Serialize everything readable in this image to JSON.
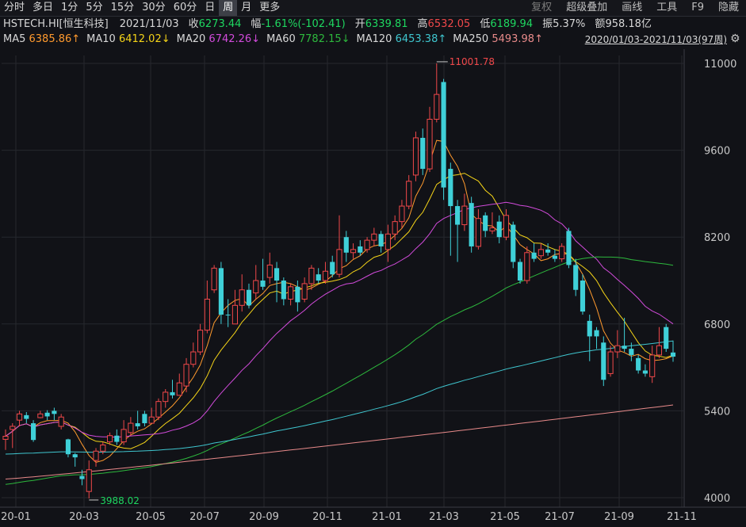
{
  "toolbar": {
    "tabs": [
      "分时",
      "多日",
      "1分",
      "5分",
      "15分",
      "30分",
      "60分",
      "日",
      "周",
      "月",
      "更多"
    ],
    "active_tab": "周",
    "tools": [
      "复权",
      "超级叠加",
      "画线",
      "工具",
      "F9",
      "隐藏"
    ]
  },
  "quote": {
    "symbol": "HSTECH.HI[恒生科技]",
    "date": "2021/11/03",
    "close_label": "收",
    "close": "6273.44",
    "change_label": "幅",
    "change": "-1.61%(-102.41)",
    "open_label": "开",
    "open": "6339.81",
    "high_label": "高",
    "high": "6532.05",
    "low_label": "低",
    "low": "6189.94",
    "amplitude_label": "振",
    "amplitude": "5.37%",
    "amount_label": "额",
    "amount": "958.18亿"
  },
  "ma_legend": [
    {
      "label": "MA5",
      "value": "6385.86↑",
      "color": "#ff9a2e"
    },
    {
      "label": "MA10",
      "value": "6412.02↓",
      "color": "#f5d418"
    },
    {
      "label": "MA20",
      "value": "6742.26↓",
      "color": "#d24bdb"
    },
    {
      "label": "MA60",
      "value": "7782.15↓",
      "color": "#2db83d"
    },
    {
      "label": "MA120",
      "value": "6453.38↑",
      "color": "#3fc6cf"
    },
    {
      "label": "MA250",
      "value": "5493.98↑",
      "color": "#e88a8a"
    }
  ],
  "range_label": "2020/01/03-2021/11/03(97周)",
  "colors": {
    "up": "#f0484a",
    "down": "#3fd0d8",
    "grid": "#26282e",
    "axis_text": "#c8c8c8"
  },
  "chart_data": {
    "type": "candlestick",
    "yticks": [
      4000,
      5400,
      6800,
      8200,
      9600,
      11000
    ],
    "ylim": [
      3900,
      11150
    ],
    "xticks": [
      "20-01",
      "20-03",
      "20-05",
      "20-07",
      "20-09",
      "20-11",
      "21-01",
      "21-03",
      "21-05",
      "21-07",
      "21-09",
      "21-11"
    ],
    "max_label": "11001.78",
    "min_label": "3988.02",
    "candles": [
      {
        "o": 4940,
        "c": 4990,
        "h": 5100,
        "l": 4770,
        "up": true
      },
      {
        "o": 5100,
        "c": 5150,
        "h": 5200,
        "l": 4800,
        "up": true
      },
      {
        "o": 5250,
        "c": 5350,
        "h": 5400,
        "l": 5150,
        "up": true
      },
      {
        "o": 5330,
        "c": 5270,
        "h": 5380,
        "l": 5200,
        "up": false
      },
      {
        "o": 5200,
        "c": 4930,
        "h": 5250,
        "l": 4900,
        "up": false
      },
      {
        "o": 5290,
        "c": 5350,
        "h": 5400,
        "l": 5280,
        "up": true
      },
      {
        "o": 5370,
        "c": 5310,
        "h": 5410,
        "l": 5250,
        "up": false
      },
      {
        "o": 5400,
        "c": 5350,
        "h": 5450,
        "l": 5250,
        "up": false
      },
      {
        "o": 5150,
        "c": 5300,
        "h": 5350,
        "l": 5100,
        "up": true
      },
      {
        "o": 4940,
        "c": 4700,
        "h": 4950,
        "l": 4650,
        "up": false
      },
      {
        "o": 4700,
        "c": 4650,
        "h": 4720,
        "l": 4500,
        "up": false
      },
      {
        "o": 4350,
        "c": 4300,
        "h": 4450,
        "l": 4200,
        "up": false
      },
      {
        "o": 4100,
        "c": 4450,
        "h": 4600,
        "l": 3988,
        "up": true
      },
      {
        "o": 4600,
        "c": 4750,
        "h": 4800,
        "l": 4500,
        "up": true
      },
      {
        "o": 4750,
        "c": 4850,
        "h": 4900,
        "l": 4700,
        "up": true
      },
      {
        "o": 4900,
        "c": 5000,
        "h": 5050,
        "l": 4850,
        "up": true
      },
      {
        "o": 5000,
        "c": 4900,
        "h": 5100,
        "l": 4850,
        "up": false
      },
      {
        "o": 4900,
        "c": 5100,
        "h": 5250,
        "l": 4850,
        "up": true
      },
      {
        "o": 5050,
        "c": 5200,
        "h": 5300,
        "l": 5000,
        "up": true
      },
      {
        "o": 5200,
        "c": 5150,
        "h": 5400,
        "l": 5100,
        "up": false
      },
      {
        "o": 5350,
        "c": 5200,
        "h": 5400,
        "l": 5150,
        "up": false
      },
      {
        "o": 5200,
        "c": 5300,
        "h": 5450,
        "l": 5200,
        "up": true
      },
      {
        "o": 5300,
        "c": 5550,
        "h": 5600,
        "l": 5250,
        "up": true
      },
      {
        "o": 5550,
        "c": 5700,
        "h": 5750,
        "l": 5450,
        "up": true
      },
      {
        "o": 5700,
        "c": 5650,
        "h": 5900,
        "l": 5600,
        "up": false
      },
      {
        "o": 5650,
        "c": 5850,
        "h": 6000,
        "l": 5650,
        "up": true
      },
      {
        "o": 5800,
        "c": 6150,
        "h": 6250,
        "l": 5700,
        "up": true
      },
      {
        "o": 6150,
        "c": 6350,
        "h": 6500,
        "l": 6100,
        "up": true
      },
      {
        "o": 6350,
        "c": 6700,
        "h": 6800,
        "l": 6300,
        "up": true
      },
      {
        "o": 6700,
        "c": 7200,
        "h": 7500,
        "l": 6650,
        "up": true
      },
      {
        "o": 7350,
        "c": 7700,
        "h": 7750,
        "l": 7300,
        "up": true
      },
      {
        "o": 7700,
        "c": 6950,
        "h": 7800,
        "l": 6800,
        "up": false
      },
      {
        "o": 6950,
        "c": 6950,
        "h": 7200,
        "l": 6750,
        "up": false
      },
      {
        "o": 6800,
        "c": 7100,
        "h": 7350,
        "l": 6800,
        "up": true
      },
      {
        "o": 7100,
        "c": 7350,
        "h": 7600,
        "l": 7000,
        "up": true
      },
      {
        "o": 7350,
        "c": 7100,
        "h": 7450,
        "l": 7050,
        "up": false
      },
      {
        "o": 7300,
        "c": 7500,
        "h": 7750,
        "l": 7200,
        "up": true
      },
      {
        "o": 7500,
        "c": 7400,
        "h": 7850,
        "l": 7350,
        "up": false
      },
      {
        "o": 7550,
        "c": 7750,
        "h": 7950,
        "l": 7450,
        "up": true
      },
      {
        "o": 7700,
        "c": 7500,
        "h": 7800,
        "l": 7150,
        "up": false
      },
      {
        "o": 7500,
        "c": 7200,
        "h": 7550,
        "l": 7100,
        "up": false
      },
      {
        "o": 7200,
        "c": 7400,
        "h": 7450,
        "l": 7100,
        "up": true
      },
      {
        "o": 7400,
        "c": 7150,
        "h": 7500,
        "l": 7000,
        "up": false
      },
      {
        "o": 7200,
        "c": 7450,
        "h": 7550,
        "l": 7150,
        "up": true
      },
      {
        "o": 7450,
        "c": 7700,
        "h": 7750,
        "l": 7350,
        "up": true
      },
      {
        "o": 7600,
        "c": 7500,
        "h": 7700,
        "l": 7450,
        "up": false
      },
      {
        "o": 7500,
        "c": 7650,
        "h": 7800,
        "l": 7450,
        "up": true
      },
      {
        "o": 7800,
        "c": 7600,
        "h": 7900,
        "l": 7550,
        "up": false
      },
      {
        "o": 7600,
        "c": 8000,
        "h": 8550,
        "l": 7550,
        "up": true
      },
      {
        "o": 8200,
        "c": 7950,
        "h": 8300,
        "l": 7800,
        "up": false
      },
      {
        "o": 7950,
        "c": 8000,
        "h": 8100,
        "l": 7850,
        "up": true
      },
      {
        "o": 8050,
        "c": 7950,
        "h": 8150,
        "l": 7900,
        "up": false
      },
      {
        "o": 8000,
        "c": 8150,
        "h": 8200,
        "l": 7950,
        "up": true
      },
      {
        "o": 8150,
        "c": 8250,
        "h": 8350,
        "l": 8050,
        "up": true
      },
      {
        "o": 8250,
        "c": 8050,
        "h": 8300,
        "l": 7950,
        "up": false
      },
      {
        "o": 8000,
        "c": 8250,
        "h": 8400,
        "l": 7800,
        "up": true
      },
      {
        "o": 8250,
        "c": 8450,
        "h": 8550,
        "l": 8150,
        "up": true
      },
      {
        "o": 8450,
        "c": 8700,
        "h": 8800,
        "l": 8350,
        "up": true
      },
      {
        "o": 8700,
        "c": 9100,
        "h": 9200,
        "l": 8650,
        "up": true
      },
      {
        "o": 9200,
        "c": 9800,
        "h": 9900,
        "l": 9100,
        "up": true
      },
      {
        "o": 9800,
        "c": 9300,
        "h": 9950,
        "l": 9200,
        "up": false
      },
      {
        "o": 9300,
        "c": 10100,
        "h": 10300,
        "l": 9250,
        "up": true
      },
      {
        "o": 10100,
        "c": 10500,
        "h": 11001,
        "l": 10050,
        "up": true
      },
      {
        "o": 10700,
        "c": 9000,
        "h": 10750,
        "l": 8800,
        "up": false
      },
      {
        "o": 9300,
        "c": 8700,
        "h": 9400,
        "l": 7900,
        "up": false
      },
      {
        "o": 8700,
        "c": 8400,
        "h": 8800,
        "l": 7800,
        "up": false
      },
      {
        "o": 8400,
        "c": 8700,
        "h": 8900,
        "l": 8300,
        "up": true
      },
      {
        "o": 8750,
        "c": 8050,
        "h": 8850,
        "l": 7950,
        "up": false
      },
      {
        "o": 8050,
        "c": 8500,
        "h": 8650,
        "l": 8000,
        "up": true
      },
      {
        "o": 8550,
        "c": 8300,
        "h": 8600,
        "l": 8200,
        "up": false
      },
      {
        "o": 8300,
        "c": 8350,
        "h": 8600,
        "l": 8250,
        "up": true
      },
      {
        "o": 8450,
        "c": 8200,
        "h": 8550,
        "l": 8100,
        "up": false
      },
      {
        "o": 8200,
        "c": 8550,
        "h": 8650,
        "l": 8150,
        "up": true
      },
      {
        "o": 8400,
        "c": 7800,
        "h": 8450,
        "l": 7700,
        "up": false
      },
      {
        "o": 7800,
        "c": 7500,
        "h": 7850,
        "l": 7450,
        "up": false
      },
      {
        "o": 7500,
        "c": 7950,
        "h": 8050,
        "l": 7450,
        "up": true
      },
      {
        "o": 7950,
        "c": 7850,
        "h": 8100,
        "l": 7800,
        "up": false
      },
      {
        "o": 7900,
        "c": 8000,
        "h": 8100,
        "l": 7850,
        "up": true
      },
      {
        "o": 8000,
        "c": 7950,
        "h": 8100,
        "l": 7900,
        "up": false
      },
      {
        "o": 7900,
        "c": 7850,
        "h": 8000,
        "l": 7800,
        "up": false
      },
      {
        "o": 7850,
        "c": 8050,
        "h": 8100,
        "l": 7800,
        "up": true
      },
      {
        "o": 8300,
        "c": 7750,
        "h": 8350,
        "l": 7700,
        "up": false
      },
      {
        "o": 7750,
        "c": 7350,
        "h": 7850,
        "l": 7250,
        "up": false
      },
      {
        "o": 7500,
        "c": 7000,
        "h": 7600,
        "l": 6950,
        "up": false
      },
      {
        "o": 6850,
        "c": 6600,
        "h": 6950,
        "l": 6200,
        "up": false
      },
      {
        "o": 6700,
        "c": 6600,
        "h": 6750,
        "l": 6400,
        "up": false
      },
      {
        "o": 6500,
        "c": 5900,
        "h": 6600,
        "l": 5800,
        "up": false
      },
      {
        "o": 6000,
        "c": 6350,
        "h": 6450,
        "l": 5950,
        "up": true
      },
      {
        "o": 6350,
        "c": 6450,
        "h": 6700,
        "l": 6250,
        "up": true
      },
      {
        "o": 6450,
        "c": 6400,
        "h": 6900,
        "l": 6350,
        "up": false
      },
      {
        "o": 6400,
        "c": 6300,
        "h": 6500,
        "l": 6200,
        "up": false
      },
      {
        "o": 6250,
        "c": 6050,
        "h": 6300,
        "l": 6000,
        "up": false
      },
      {
        "o": 6050,
        "c": 6000,
        "h": 6150,
        "l": 5950,
        "up": false
      },
      {
        "o": 5950,
        "c": 6300,
        "h": 6450,
        "l": 5850,
        "up": true
      },
      {
        "o": 6300,
        "c": 6450,
        "h": 6750,
        "l": 6250,
        "up": true
      },
      {
        "o": 6750,
        "c": 6400,
        "h": 6800,
        "l": 6350,
        "up": false
      },
      {
        "o": 6340,
        "c": 6273,
        "h": 6532,
        "l": 6190,
        "up": false
      }
    ]
  }
}
